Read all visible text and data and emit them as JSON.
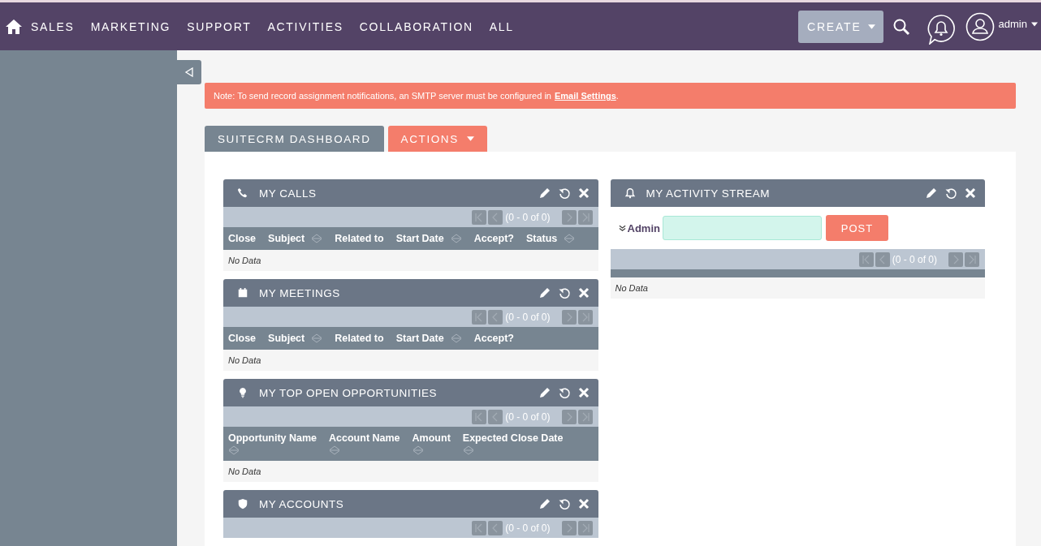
{
  "nav": {
    "items": [
      "SALES",
      "MARKETING",
      "SUPPORT",
      "ACTIVITIES",
      "COLLABORATION",
      "ALL"
    ],
    "create": "CREATE",
    "user": "admin"
  },
  "notice": {
    "text": "Note: To send record assignment notifications, an SMTP server must be configured in",
    "link": "Email Settings",
    "suffix": "."
  },
  "tabs": [
    {
      "label": "SUITECRM DASHBOARD",
      "kind": "tab"
    },
    {
      "label": "ACTIONS",
      "kind": "menu"
    }
  ],
  "left_dashlets": [
    {
      "title": "MY CALLS",
      "pager": "(0 - 0 of 0)",
      "columns": [
        {
          "label": "Close",
          "sortable": false
        },
        {
          "label": "Subject",
          "sortable": true
        },
        {
          "label": "Related to",
          "sortable": false
        },
        {
          "label": "Start Date",
          "sortable": true
        },
        {
          "label": "Accept?",
          "sortable": false
        },
        {
          "label": "Status",
          "sortable": true
        }
      ],
      "sort_below": false,
      "empty": "No Data"
    },
    {
      "title": "MY MEETINGS",
      "pager": "(0 - 0 of 0)",
      "columns": [
        {
          "label": "Close",
          "sortable": false
        },
        {
          "label": "Subject",
          "sortable": true
        },
        {
          "label": "Related to",
          "sortable": false
        },
        {
          "label": "Start Date",
          "sortable": true
        },
        {
          "label": "Accept?",
          "sortable": false
        }
      ],
      "sort_below": false,
      "empty": "No Data"
    },
    {
      "title": "MY TOP OPEN OPPORTUNITIES",
      "pager": "(0 - 0 of 0)",
      "columns": [
        {
          "label": "Opportunity Name",
          "sortable": true
        },
        {
          "label": "Account Name",
          "sortable": true
        },
        {
          "label": "Amount",
          "sortable": true
        },
        {
          "label": "Expected Close Date",
          "sortable": true
        }
      ],
      "sort_below": true,
      "empty": "No Data"
    },
    {
      "title": "MY ACCOUNTS",
      "pager": "(0 - 0 of 0)"
    }
  ],
  "activity": {
    "title": "MY ACTIVITY STREAM",
    "user": "Admin",
    "post": "POST",
    "pager": "(0 - 0 of 0)",
    "empty": "No Data"
  }
}
